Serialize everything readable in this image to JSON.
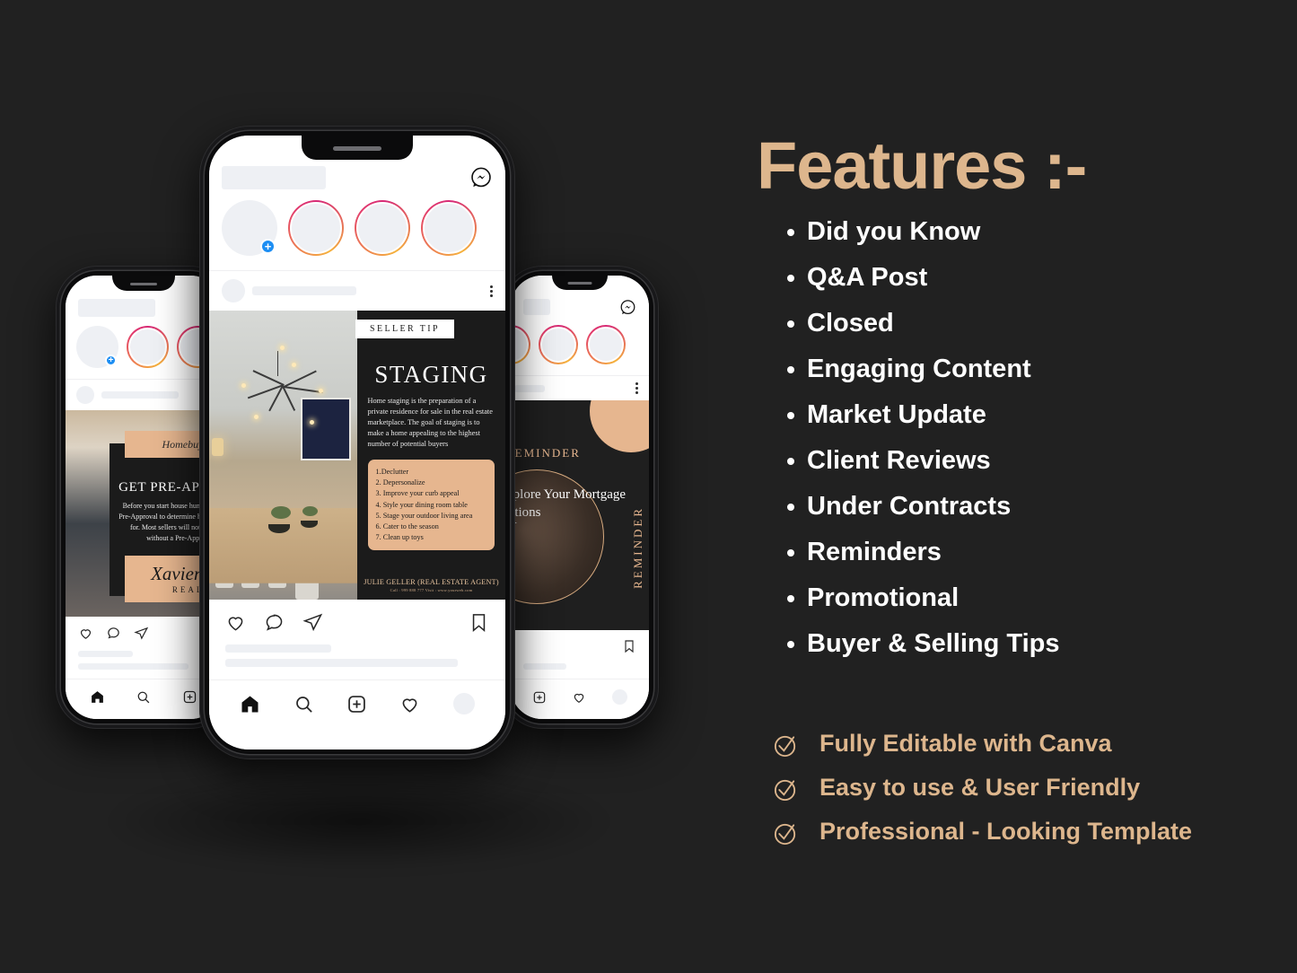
{
  "theme": {
    "background": "#212121",
    "accent_gold": "#ddb68d",
    "text_white": "#ffffff",
    "panel_dark": "#1b1b1b",
    "tan_card": "#e6b68f",
    "instagram_blue": "#1d8ef3"
  },
  "panel": {
    "title": "Features :-",
    "features": [
      "Did you Know",
      "Q&A Post",
      "Closed",
      "Engaging Content",
      "Market Update",
      "Client Reviews",
      "Under Contracts",
      "Reminders",
      "Promotional",
      "Buyer & Selling Tips"
    ],
    "checks": [
      "Fully Editable with Canva",
      "Easy to use & User Friendly",
      "Professional - Looking Template"
    ]
  },
  "phones": {
    "center": {
      "app": "Instagram",
      "post": {
        "badge": "SELLER TIP",
        "title": "STAGING",
        "body": "Home staging is the preparation of a private residence for sale in the real estate marketplace. The goal of staging is to make a home appealing to the highest number of potential buyers",
        "steps": [
          "1.Declutter",
          "2. Depersonalize",
          "3. Improve your curb appeal",
          "4. Style your dining room table",
          "5. Stage your outdoor living area",
          "6. Cater to the season",
          "7. Clean up toys"
        ],
        "footer_name": "JULIE GELLER (REAL ESTATE AGENT)",
        "footer_contact": "Call : 999 888 777   Visit : www.yourweb.com"
      },
      "tabbar": [
        "home-icon",
        "search-icon",
        "add-post-icon",
        "activity-icon",
        "profile-avatar"
      ],
      "post_actions": [
        "like-icon",
        "comment-icon",
        "share-icon",
        "save-icon"
      ]
    },
    "left": {
      "post": {
        "ribbon": "Homebuying Tips",
        "title": "GET PRE-APPROVED",
        "body": "Before you start house hunting, get a Mortgage Pre-Approval to determine how much you qualify for. Most sellers will not consider an offer without a Pre-Approval Letter.",
        "signature": "Xavier Smith",
        "role": "REALTOR"
      }
    },
    "right": {
      "post": {
        "top_label": "REMINDER",
        "title": "Explore Your Mortgage Options",
        "side_label": "REMINDER"
      }
    }
  }
}
